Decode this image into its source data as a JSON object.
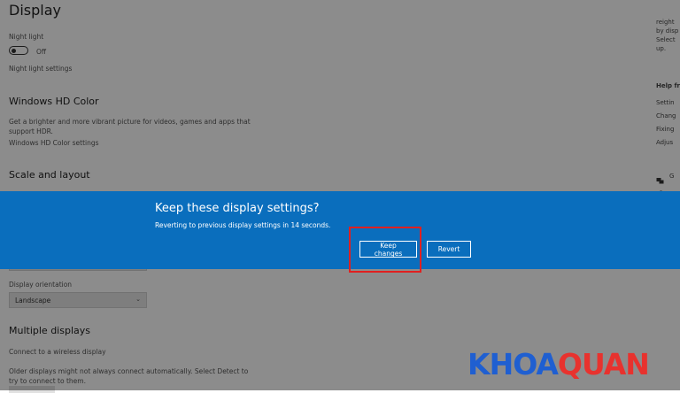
{
  "page": {
    "title": "Display",
    "night_light": {
      "label": "Night light",
      "state": "Off",
      "settings_link": "Night light settings"
    },
    "hd_color": {
      "heading": "Windows HD Color",
      "description_line1": "Get a brighter and more vibrant picture for videos, games and apps that",
      "description_line2": "support HDR.",
      "settings_link": "Windows HD Color settings"
    },
    "scale_layout": {
      "heading": "Scale and layout"
    },
    "orientation": {
      "label": "Display orientation",
      "value": "Landscape"
    },
    "multiple_displays": {
      "heading": "Multiple displays",
      "wireless_link": "Connect to a wireless display",
      "detect_line1": "Older displays might not always connect automatically. Select Detect to",
      "detect_line2": "try to connect to them."
    }
  },
  "right_panel": {
    "lines": [
      "reight",
      "by disp",
      "Select",
      "up."
    ],
    "help_heading": "Help fr",
    "help_items": [
      "Settin",
      "Chang",
      "Fixing",
      "Adjus"
    ],
    "icon_items": [
      "G"
    ]
  },
  "dialog": {
    "title": "Keep these display settings?",
    "message": "Reverting to previous display settings in 14 seconds.",
    "keep_label": "Keep changes",
    "revert_label": "Revert"
  },
  "watermark": {
    "part1": "KHOA",
    "part2": "QUAN"
  },
  "colors": {
    "banner": "#0a6ebd",
    "highlight": "#e02020",
    "logo_blue": "#1f5fd1",
    "logo_red": "#e8322e"
  }
}
